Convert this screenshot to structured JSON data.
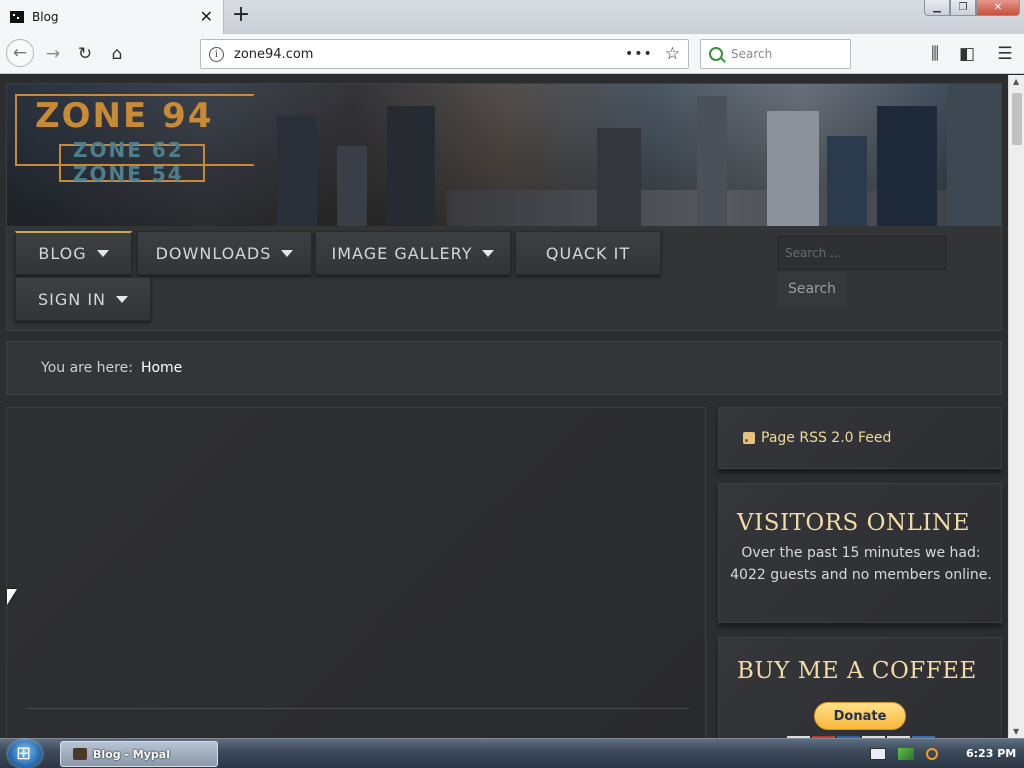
{
  "browser": {
    "tab_title": "Blog",
    "tab_close": "✕",
    "new_tab": "+",
    "url": "zone94.com",
    "page_actions": "•••",
    "search_placeholder": "Search",
    "icons": {
      "back": "arrow-left-icon",
      "forward": "arrow-right-icon",
      "reload": "reload-icon",
      "home": "home-icon",
      "library": "library-icon",
      "sidebar": "sidebar-icon",
      "menu": "hamburger-icon"
    }
  },
  "site": {
    "logo": {
      "main": "ZONE 94",
      "sub1": "ZONE 62",
      "sub2": "ZONE 54"
    },
    "menu": {
      "blog": "BLOG",
      "downloads": "DOWNLOADS",
      "gallery": "IMAGE GALLERY",
      "quack": "QUACK IT",
      "signin": "SIGN IN"
    },
    "search": {
      "placeholder": "Search ...",
      "button": "Search"
    },
    "breadcrumb": {
      "label": "You are here:",
      "current": "Home"
    },
    "sidebar": {
      "rss": "Page RSS 2.0 Feed",
      "visitors_title": "VISITORS ONLINE",
      "visitors_text": "Over the past 15 minutes we had: 4022 guests and no members online.",
      "coffee_title": "BUY ME A COFFEE",
      "donate": "Donate"
    },
    "colors": {
      "accent_gold": "#f2dca4",
      "background": "#2c2d2f"
    }
  },
  "taskbar": {
    "task_label": "Blog - Mypal",
    "clock": "6:23 PM"
  }
}
